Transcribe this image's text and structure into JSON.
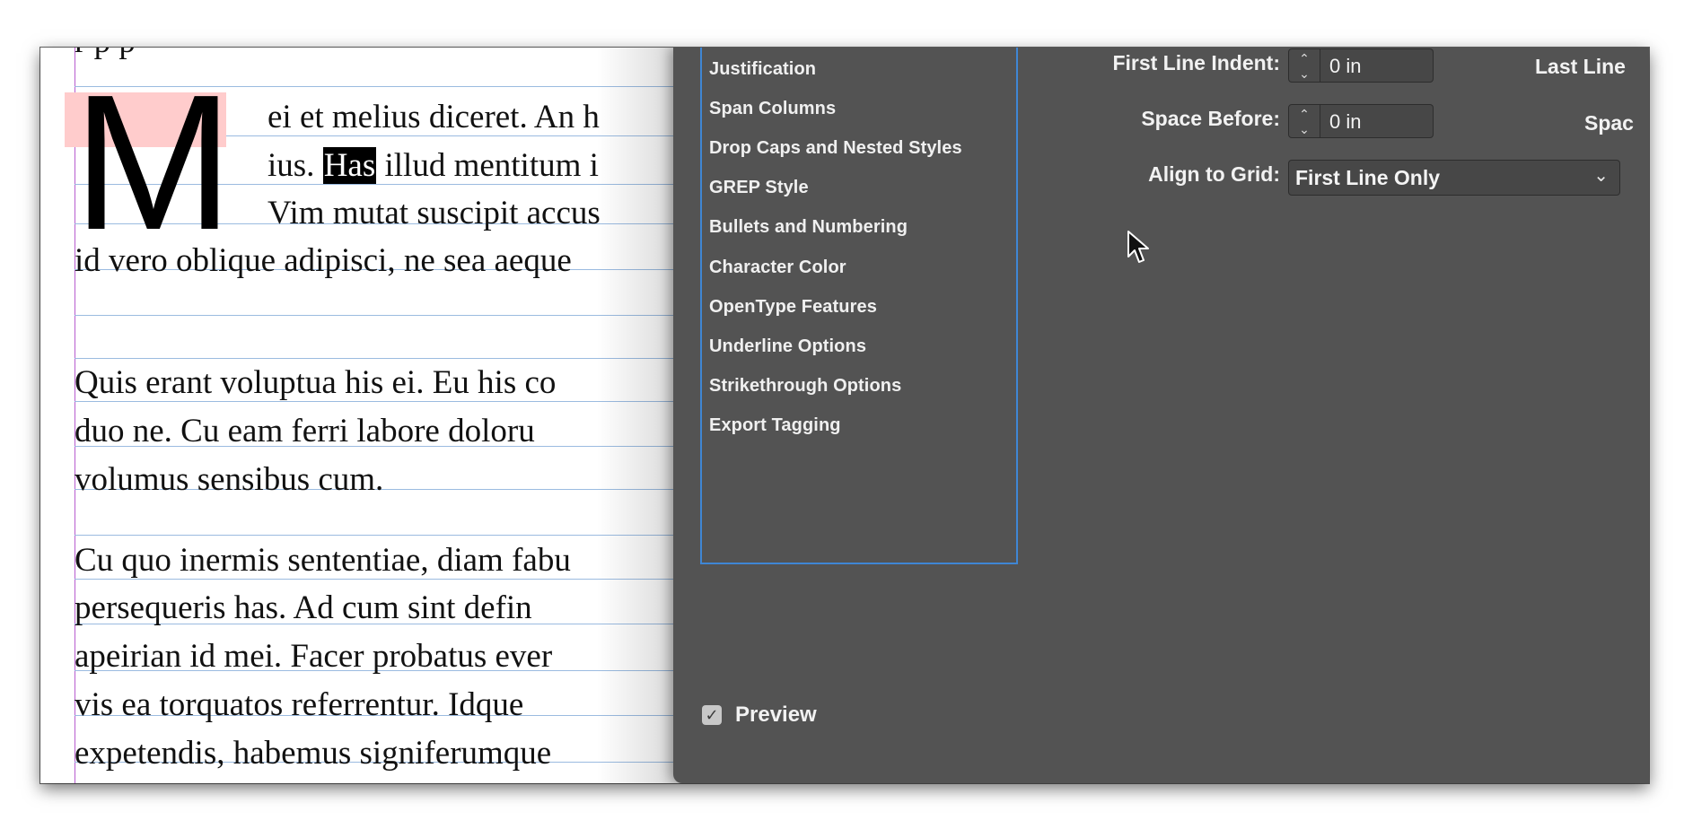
{
  "document": {
    "top_partial_text": "r          p                        p",
    "dropcap_letter": "M",
    "para1_lines": [
      "ei et melius diceret. An h",
      "illud mentitum i",
      "Vim mutat suscipit accus",
      "id vero oblique adipisci, ne sea aeque"
    ],
    "para1_line2_prefix": "ius. ",
    "selected_word": "Has",
    "para2_lines": [
      "Quis erant voluptua his ei. Eu his co",
      "duo ne. Cu eam ferri labore doloru",
      "volumus sensibus cum."
    ],
    "para3_lines": [
      "Cu quo inermis sententiae, diam fabu",
      "persequeris has. Ad cum sint defin",
      "apeirian id mei. Facer probatus ever",
      "vis ea torquatos referrentur. Idque",
      "expetendis, habemus signiferumque"
    ]
  },
  "dialog": {
    "categories": [
      "Justification",
      "Span Columns",
      "Drop Caps and Nested Styles",
      "GREP Style",
      "Bullets and Numbering",
      "Character Color",
      "OpenType Features",
      "Underline Options",
      "Strikethrough Options",
      "Export Tagging"
    ],
    "fields": {
      "first_line_indent_label": "First Line Indent:",
      "first_line_indent_value": "0 in",
      "space_before_label": "Space Before:",
      "space_before_value": "0 in",
      "align_to_grid_label": "Align to Grid:",
      "align_to_grid_value": "First Line Only",
      "last_line_label": "Last Line",
      "space_after_label": "Spac"
    },
    "preview_label": "Preview",
    "preview_checked": true
  },
  "icons": {
    "stepper": "stepper-up-down-icon",
    "dropdown": "chevron-down-icon",
    "checkbox": "checkmark-icon",
    "cursor": "mouse-pointer-icon"
  }
}
